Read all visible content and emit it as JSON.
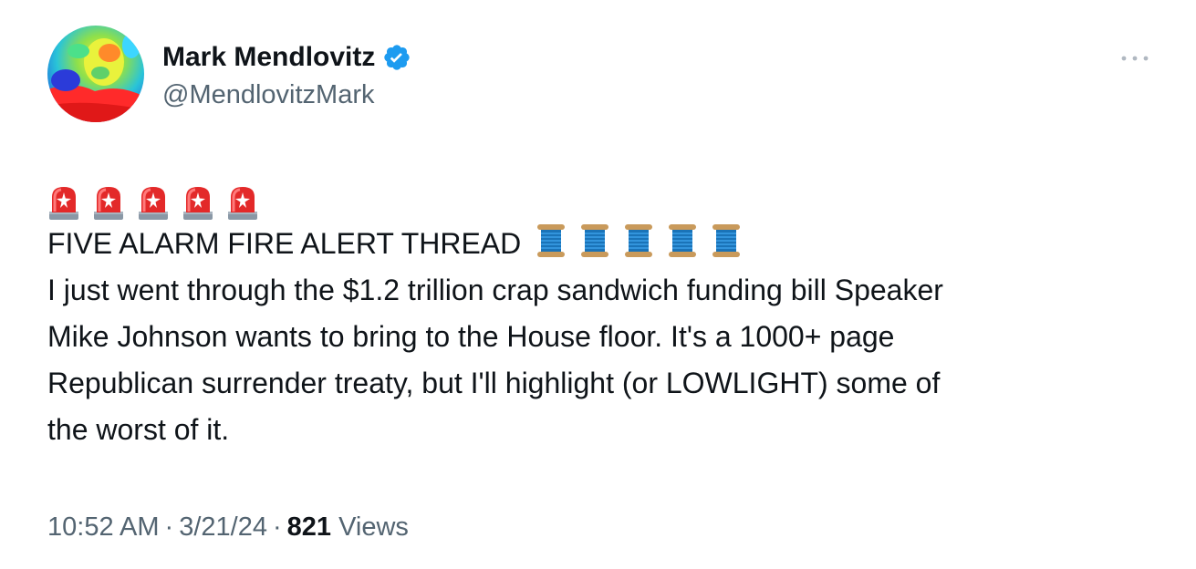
{
  "author": {
    "name": "Mark Mendlovitz",
    "handle": "@MendlovitzMark",
    "verified": true
  },
  "tweet": {
    "emoji_prefix": [
      "siren-emoji",
      "siren-emoji",
      "siren-emoji",
      "siren-emoji",
      "siren-emoji"
    ],
    "headline": "FIVE ALARM FIRE ALERT THREAD",
    "headline_emoji": [
      "thread-spool-emoji",
      "thread-spool-emoji",
      "thread-spool-emoji",
      "thread-spool-emoji",
      "thread-spool-emoji"
    ],
    "lines": [
      "I just went through the $1.2 trillion crap sandwich funding bill Speaker",
      "Mike Johnson wants to bring to the House floor. It's a 1000+ page",
      "Republican surrender treaty, but I'll highlight (or LOWLIGHT) some of",
      "the worst of it."
    ]
  },
  "meta": {
    "time": "10:52 AM",
    "separator": "·",
    "date": "3/21/24",
    "views_count": "821",
    "views_label": "Views"
  },
  "colors": {
    "text_primary": "#0f1419",
    "text_secondary": "#536471",
    "verified_blue": "#1d9bf0"
  }
}
